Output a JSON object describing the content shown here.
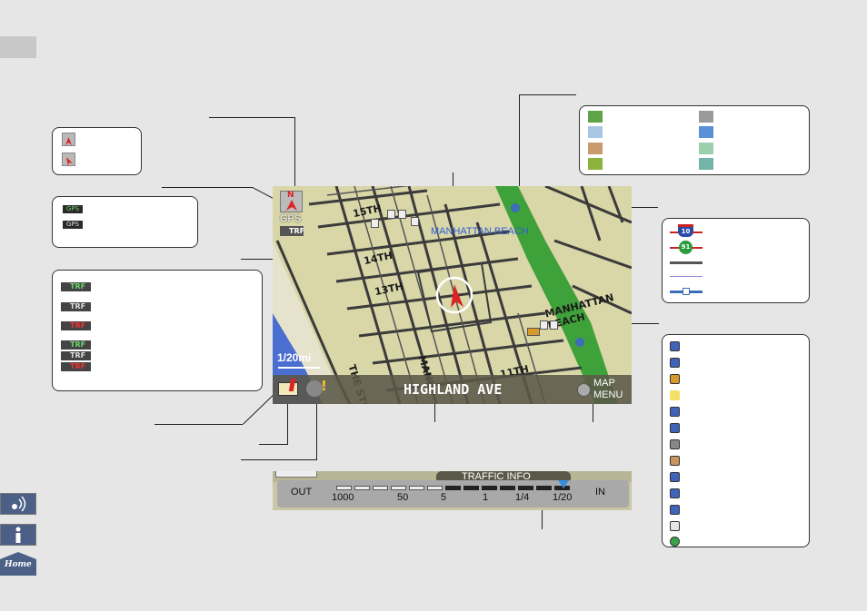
{
  "map": {
    "compass_label": "N",
    "gps_label": "GPS",
    "traffic_label": "TRF",
    "streets": [
      "15TH",
      "14TH",
      "13TH",
      "THE STRAND",
      "MANH",
      "11TH"
    ],
    "area_labels": [
      "MANHATTAN BEACH",
      "MANHATTAN BEACH"
    ],
    "scale": "1/20mi",
    "road_name": "HIGHLAND AVE",
    "menu_line1": "MAP",
    "menu_line2": "MENU"
  },
  "traffic_info": {
    "title": "TRAFFIC INFO",
    "out_label": "OUT",
    "in_label": "IN",
    "scale_labels": [
      "1000",
      "50",
      "5",
      "1",
      "1/4",
      "1/20"
    ]
  },
  "legends": {
    "gps_icons": [
      "GPS",
      "GPS"
    ],
    "traffic_icons": [
      "TRF",
      "TRF",
      "TRF",
      "TRF",
      "TRF",
      "TRF"
    ],
    "freeway_shields": [
      "10",
      "91"
    ]
  },
  "colors": {
    "map_land": "#d9d6a8",
    "water": "#4a6fd0",
    "park": "#3fa13a",
    "road_bar": "#6e6b5a",
    "swatches": [
      "#5ea347",
      "#9a9a9a",
      "#a7c7e4",
      "#5b8fd8",
      "#c99a6d",
      "#9ccfae",
      "#8db33e",
      "#74b3aa"
    ]
  },
  "icons": {
    "compass": "compass-north-icon",
    "heading": "heading-arrow-icon",
    "mic": "voice-command-icon",
    "info": "info-icon",
    "home": "home-icon"
  },
  "sidebar": {
    "home_label": "Home"
  }
}
